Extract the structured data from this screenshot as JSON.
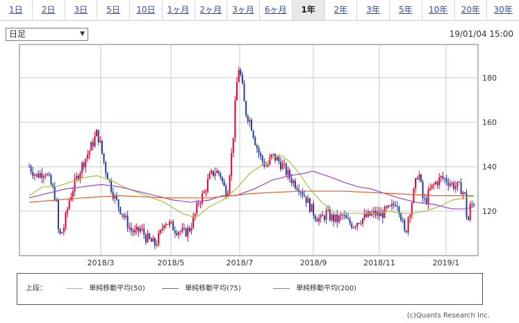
{
  "tabs": [
    "1日",
    "2日",
    "3日",
    "5日",
    "10日",
    "1ヶ月",
    "2ヶ月",
    "3ヶ月",
    "6ヶ月",
    "1年",
    "2年",
    "3年",
    "5年",
    "10年",
    "20年",
    "30年"
  ],
  "active_tab": "1年",
  "select": {
    "value": "日足"
  },
  "datetime": "19/01/04 15:00",
  "chart_data": {
    "type": "candlestick",
    "x_tick_labels": [
      "2018/3",
      "2018/5",
      "2018/7",
      "2018/9",
      "2018/11",
      "2019/1"
    ],
    "y_tick_labels": [
      "120",
      "140",
      "160",
      "180"
    ],
    "ylim": [
      100,
      195
    ],
    "grid": true,
    "up_color": "#e8002d",
    "down_color": "#1f3aa6",
    "ohlc_anchors": [
      [
        0,
        140
      ],
      [
        8,
        136
      ],
      [
        18,
        138
      ],
      [
        26,
        130
      ],
      [
        30,
        125
      ],
      [
        33,
        108
      ],
      [
        38,
        112
      ],
      [
        45,
        126
      ],
      [
        52,
        134
      ],
      [
        58,
        140
      ],
      [
        64,
        145
      ],
      [
        70,
        150
      ],
      [
        75,
        155
      ],
      [
        78,
        152
      ],
      [
        84,
        140
      ],
      [
        90,
        132
      ],
      [
        95,
        126
      ],
      [
        100,
        122
      ],
      [
        106,
        117
      ],
      [
        112,
        112
      ],
      [
        118,
        110
      ],
      [
        124,
        112
      ],
      [
        130,
        108
      ],
      [
        136,
        106
      ],
      [
        140,
        105
      ],
      [
        146,
        110
      ],
      [
        150,
        116
      ],
      [
        156,
        114
      ],
      [
        162,
        112
      ],
      [
        168,
        111
      ],
      [
        172,
        110
      ],
      [
        178,
        112
      ],
      [
        184,
        118
      ],
      [
        188,
        124
      ],
      [
        194,
        128
      ],
      [
        200,
        135
      ],
      [
        206,
        138
      ],
      [
        212,
        137
      ],
      [
        216,
        131
      ],
      [
        220,
        128
      ],
      [
        226,
        150
      ],
      [
        230,
        175
      ],
      [
        233,
        185
      ],
      [
        236,
        178
      ],
      [
        240,
        165
      ],
      [
        246,
        160
      ],
      [
        252,
        150
      ],
      [
        258,
        143
      ],
      [
        264,
        140
      ],
      [
        270,
        145
      ],
      [
        276,
        143
      ],
      [
        282,
        140
      ],
      [
        288,
        136
      ],
      [
        294,
        133
      ],
      [
        300,
        131
      ],
      [
        306,
        127
      ],
      [
        312,
        122
      ],
      [
        318,
        118
      ],
      [
        324,
        116
      ],
      [
        330,
        119
      ],
      [
        336,
        117
      ],
      [
        342,
        116
      ],
      [
        348,
        118
      ],
      [
        354,
        115
      ],
      [
        360,
        114
      ],
      [
        366,
        116
      ],
      [
        372,
        117
      ],
      [
        378,
        118
      ],
      [
        384,
        119
      ],
      [
        390,
        118
      ],
      [
        396,
        120
      ],
      [
        402,
        121
      ],
      [
        408,
        125
      ],
      [
        412,
        120
      ],
      [
        416,
        112
      ],
      [
        418,
        108
      ],
      [
        420,
        116
      ],
      [
        424,
        122
      ],
      [
        428,
        130
      ],
      [
        432,
        138
      ],
      [
        434,
        135
      ],
      [
        437,
        126
      ],
      [
        440,
        124
      ],
      [
        446,
        130
      ],
      [
        452,
        133
      ],
      [
        458,
        135
      ],
      [
        464,
        134
      ],
      [
        470,
        132
      ],
      [
        476,
        131
      ],
      [
        480,
        130
      ],
      [
        484,
        127
      ],
      [
        486,
        118
      ],
      [
        488,
        116
      ],
      [
        490,
        122
      ],
      [
        494,
        124
      ]
    ],
    "series": [
      {
        "name": "単純移動平均(50)",
        "color": "#a5c23a",
        "values": [
          [
            0,
            127
          ],
          [
            15,
            131
          ],
          [
            30,
            131
          ],
          [
            45,
            133
          ],
          [
            60,
            135
          ],
          [
            75,
            136
          ],
          [
            90,
            134
          ],
          [
            110,
            130
          ],
          [
            130,
            127
          ],
          [
            150,
            124
          ],
          [
            170,
            119
          ],
          [
            185,
            117
          ],
          [
            200,
            122
          ],
          [
            215,
            125
          ],
          [
            230,
            130
          ],
          [
            245,
            137
          ],
          [
            260,
            141
          ],
          [
            270,
            144
          ],
          [
            280,
            145
          ],
          [
            290,
            142
          ],
          [
            300,
            137
          ],
          [
            310,
            131
          ],
          [
            325,
            124
          ],
          [
            340,
            119
          ],
          [
            355,
            119
          ],
          [
            370,
            119
          ],
          [
            385,
            119
          ],
          [
            400,
            120
          ],
          [
            415,
            119
          ],
          [
            425,
            119
          ],
          [
            440,
            120
          ],
          [
            455,
            122
          ],
          [
            470,
            125
          ],
          [
            485,
            126
          ],
          [
            494,
            127
          ]
        ]
      },
      {
        "name": "単純移動平均(75)",
        "color": "#9a41d6",
        "values": [
          [
            0,
            126
          ],
          [
            20,
            128
          ],
          [
            40,
            130
          ],
          [
            60,
            131
          ],
          [
            80,
            132
          ],
          [
            100,
            131
          ],
          [
            120,
            129
          ],
          [
            140,
            127
          ],
          [
            160,
            125
          ],
          [
            180,
            124
          ],
          [
            200,
            125
          ],
          [
            215,
            127
          ],
          [
            230,
            127
          ],
          [
            250,
            130
          ],
          [
            270,
            134
          ],
          [
            290,
            136
          ],
          [
            305,
            137
          ],
          [
            315,
            138
          ],
          [
            330,
            136
          ],
          [
            350,
            133
          ],
          [
            365,
            131
          ],
          [
            380,
            130
          ],
          [
            395,
            128
          ],
          [
            410,
            126
          ],
          [
            430,
            124
          ],
          [
            450,
            123
          ],
          [
            470,
            121
          ],
          [
            485,
            121
          ],
          [
            494,
            122
          ]
        ]
      },
      {
        "name": "単純移動平均(200)",
        "color": "#ef5a22",
        "values": [
          [
            0,
            124
          ],
          [
            30,
            125
          ],
          [
            60,
            126
          ],
          [
            100,
            127
          ],
          [
            150,
            126
          ],
          [
            200,
            126
          ],
          [
            250,
            128
          ],
          [
            300,
            129
          ],
          [
            350,
            129
          ],
          [
            400,
            128
          ],
          [
            450,
            127
          ],
          [
            494,
            127
          ]
        ]
      }
    ]
  },
  "legend": {
    "label": "上段："
  },
  "copyright": "(c)Quants Research Inc."
}
